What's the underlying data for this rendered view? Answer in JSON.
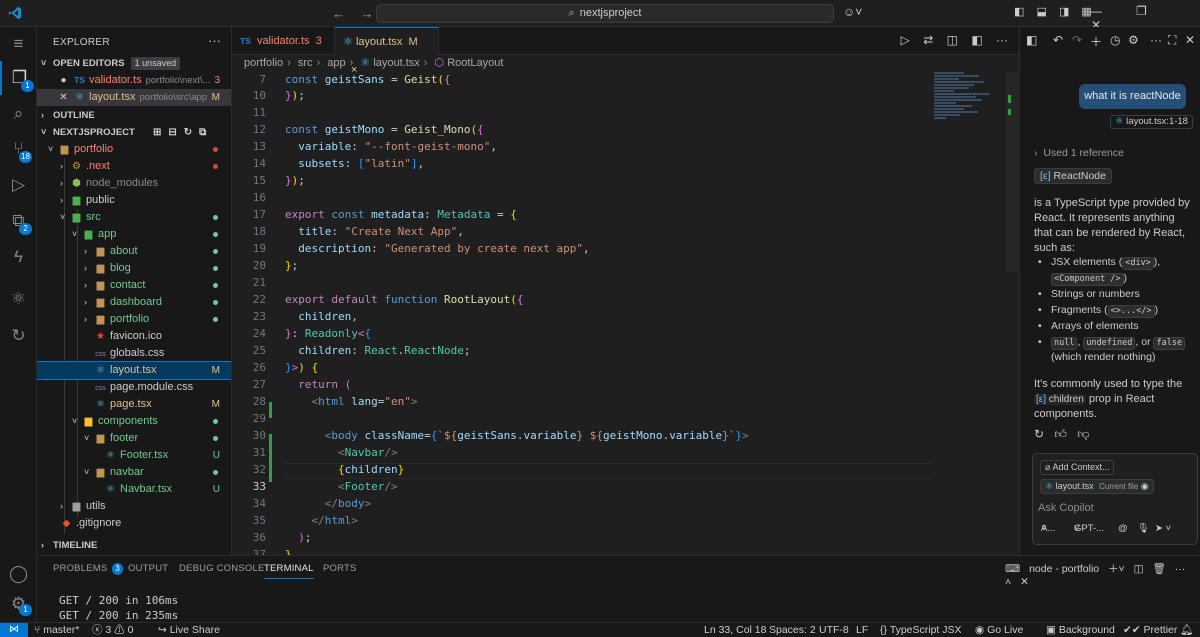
{
  "titlebar": {
    "search": "nextjsproject",
    "back_icon": "←",
    "forward_icon": "→"
  },
  "activity": {
    "explorer_badge": "1",
    "scm_badge": "18",
    "ext_badge": "2"
  },
  "sidebar": {
    "title": "EXPLORER",
    "open_editors": {
      "header": "OPEN EDITORS",
      "badge": "1 unsaved",
      "items": [
        {
          "name": "validator.ts",
          "path": "portfolio\\next\\...",
          "status": "3"
        },
        {
          "name": "layout.tsx",
          "path": "portfolio\\src\\app",
          "status": "M"
        }
      ]
    },
    "outline_header": "OUTLINE",
    "project_header": "NEXTJSPROJECT",
    "tree": [
      {
        "label": "portfolio",
        "status": ""
      },
      {
        "label": ".next",
        "status": ""
      },
      {
        "label": "node_modules",
        "status": ""
      },
      {
        "label": "public",
        "status": ""
      },
      {
        "label": "src",
        "status": ""
      },
      {
        "label": "app",
        "status": ""
      },
      {
        "label": "about",
        "status": ""
      },
      {
        "label": "blog",
        "status": ""
      },
      {
        "label": "contact",
        "status": ""
      },
      {
        "label": "dashboard",
        "status": ""
      },
      {
        "label": "portfolio",
        "status": ""
      },
      {
        "label": "favicon.ico",
        "status": ""
      },
      {
        "label": "globals.css",
        "status": ""
      },
      {
        "label": "layout.tsx",
        "status": "M"
      },
      {
        "label": "page.module.css",
        "status": ""
      },
      {
        "label": "page.tsx",
        "status": "M"
      },
      {
        "label": "components",
        "status": ""
      },
      {
        "label": "footer",
        "status": ""
      },
      {
        "label": "Footer.tsx",
        "status": "U"
      },
      {
        "label": "navbar",
        "status": ""
      },
      {
        "label": "Navbar.tsx",
        "status": "U"
      },
      {
        "label": "utils",
        "status": ""
      },
      {
        "label": ".gitignore",
        "status": ""
      }
    ],
    "timeline_header": "TIMELINE"
  },
  "editor": {
    "tabs": [
      {
        "type": "TS",
        "label": "validator.ts",
        "count": "3"
      },
      {
        "type": "tsx",
        "label": "layout.tsx",
        "count": "M",
        "close": "×"
      }
    ],
    "breadcrumb": [
      "portfolio",
      "src",
      "app",
      "layout.tsx",
      "RootLayout"
    ],
    "cursor_line": 33
  },
  "panel": {
    "tabs": [
      "PROBLEMS",
      "OUTPUT",
      "DEBUG CONSOLE",
      "TERMINAL",
      "PORTS"
    ],
    "problems_count": "3",
    "active_tab": "TERMINAL",
    "terminal_name": "node - portfolio",
    "terminal_lines": [
      "GET / 200 in 106ms",
      "GET / 200 in 235ms"
    ]
  },
  "statusbar": {
    "branch": "master*",
    "errors": "3",
    "warnings": "0",
    "live_share": "Live Share",
    "position": "Ln 33, Col 18",
    "spaces": "Spaces: 2",
    "encoding": "UTF-8",
    "eol": "LF",
    "language": "TypeScript JSX",
    "go_live": "Go Live",
    "background": "Background",
    "prettier": "Prettier"
  },
  "chat": {
    "user_message": "what it is reactNode",
    "ref_chip": "layout.tsx:1-18",
    "used_reference": "Used 1 reference",
    "reference_name": "ReactNode",
    "answer_intro": "is a TypeScript type provided by React. It represents anything that can be rendered by React, such as:",
    "list": {
      "jsx": "JSX elements (",
      "div": "<div>",
      "comp": "<Component />",
      "strings": "Strings or numbers",
      "fragments": "Fragments (",
      "frag": "<>...</>",
      "arrays": "Arrays of elements",
      "null": "null",
      "undefined": "undefined",
      "or": ", or",
      "false": "false",
      "render_nothing": "(which render nothing)"
    },
    "answer_outro_1": "It's commonly used to type the",
    "children_chip": "children",
    "answer_outro_2": "prop in React components.",
    "add_context": "Add Context...",
    "current_file": "layout.tsx",
    "current_file_label": "Current file",
    "ask_placeholder": "Ask Copilot",
    "mode": "A...",
    "model": "GPT-..."
  }
}
